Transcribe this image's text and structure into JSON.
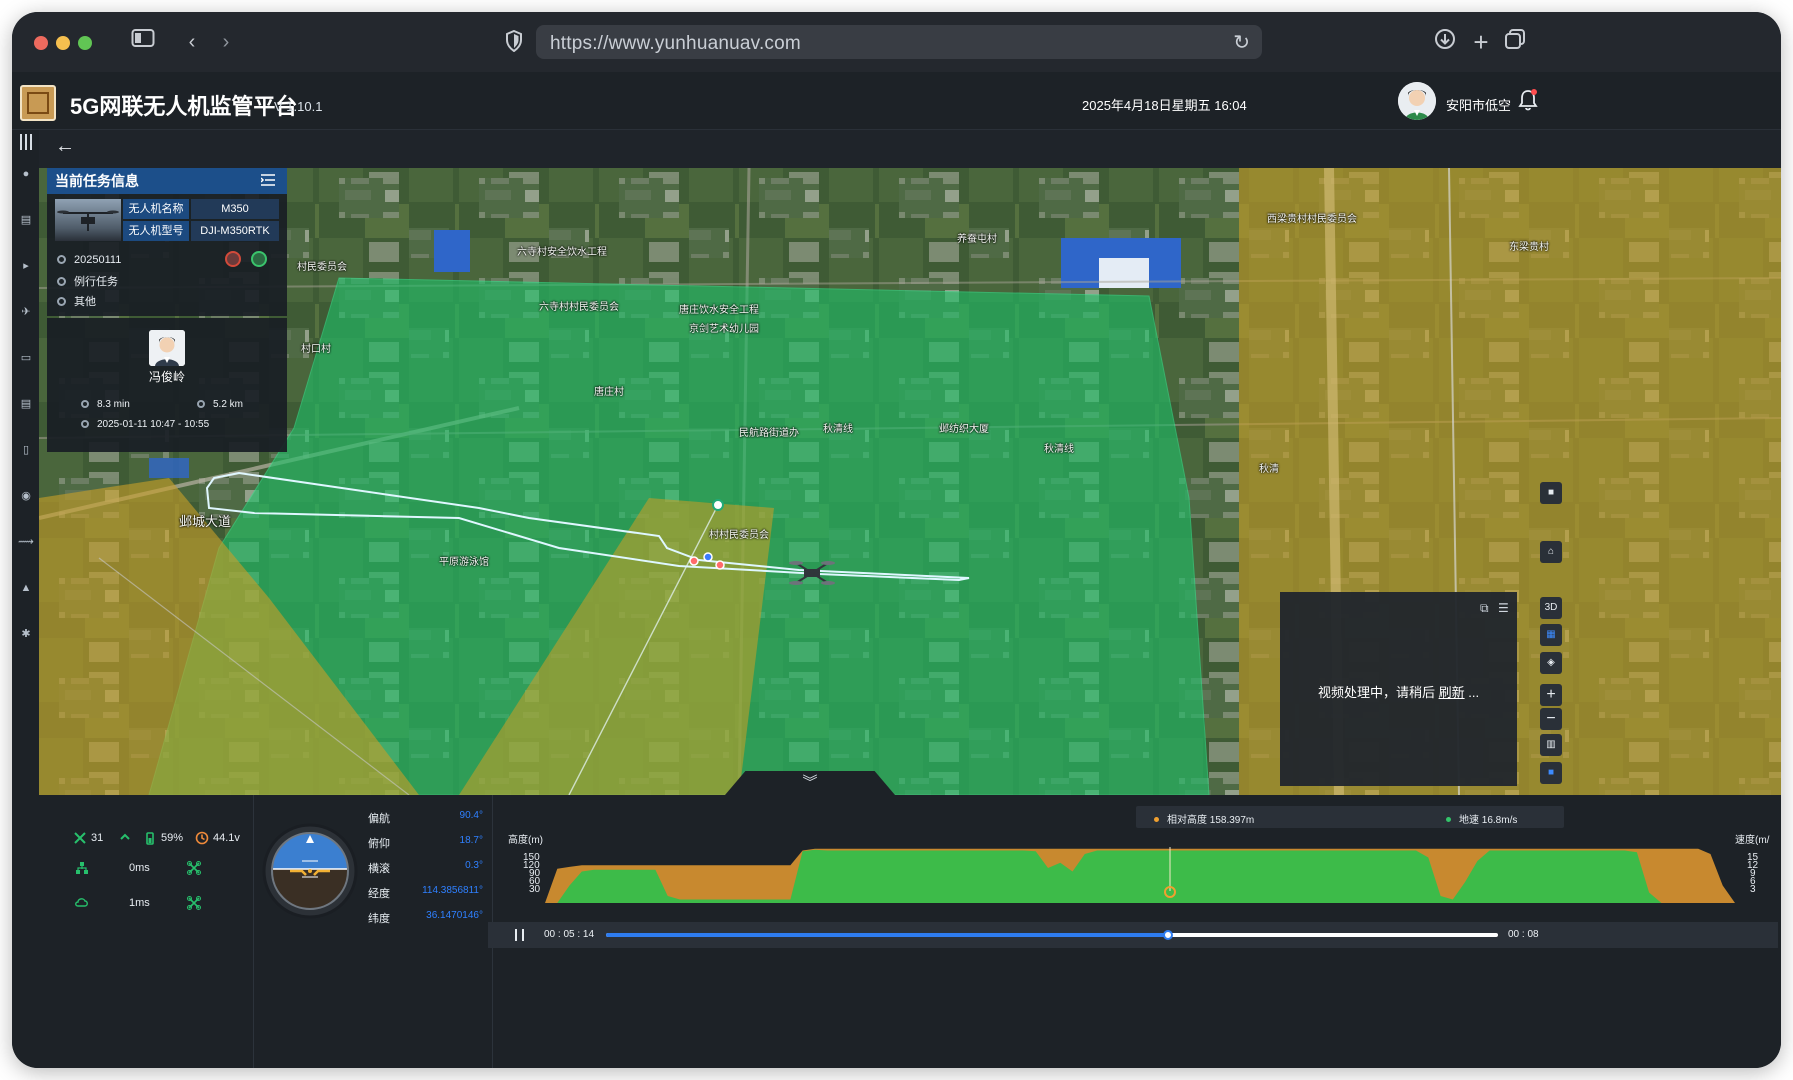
{
  "browser": {
    "url": "https://www.yunhuanuav.com"
  },
  "app": {
    "title": "5G网联无人机监管平台",
    "version": "V 1.10.1",
    "datetime": "2025年4月18日星期五 16:04",
    "user": "安阳市低空"
  },
  "task_panel": {
    "title": "当前任务信息",
    "drone_name_label": "无人机名称",
    "drone_name_value": "M350",
    "drone_model_label": "无人机型号",
    "drone_model_value": "DJI-M350RTK",
    "task_id": "20250111",
    "task_type": "例行任务",
    "task_category": "其他"
  },
  "pilot_panel": {
    "name": "冯俊岭",
    "duration": "8.3 min",
    "distance": "5.2 km",
    "time_range": "2025-01-11 10:47 - 10:55"
  },
  "map": {
    "labels": [
      "六寺村安全饮水工程",
      "养蚕屯村",
      "村民委员会",
      "六寺村村民委员会",
      "唐庄饮水安全工程",
      "京剑艺术幼儿园",
      "村口村",
      "唐庄村",
      "民航路街道办",
      "秋清线",
      "邺纺织大厦",
      "秋清线",
      "秋清",
      "邺城大道",
      "村村民委员会",
      "平原游泳馆",
      "西梁贵村村民委员会",
      "东梁贵村"
    ],
    "controls": [
      "3D"
    ],
    "colors": {
      "green_zone": "#1fbf68",
      "yellow_zone": "#c79e28",
      "track": "#dff7ff"
    }
  },
  "video": {
    "message_prefix": "视频处理中，请稍后",
    "message_link": "刷新",
    "message_suffix": "..."
  },
  "telemetry": {
    "satellites": "31",
    "battery": "59%",
    "voltage": "44.1v",
    "latency_1": "0ms",
    "latency_2": "1ms",
    "attitude": [
      {
        "label": "偏航",
        "value": "90.4°"
      },
      {
        "label": "俯仰",
        "value": "18.7°"
      },
      {
        "label": "横滚",
        "value": "0.3°"
      },
      {
        "label": "经度",
        "value": "114.3856811°"
      },
      {
        "label": "纬度",
        "value": "36.1470146°"
      }
    ]
  },
  "chart_data": {
    "type": "area",
    "xlabel": "",
    "ylabel_left": "高度(m)",
    "ylabel_right": "速度(m/",
    "left_ticks": [
      "150",
      "120",
      "90",
      "60",
      "30"
    ],
    "right_ticks": [
      "15",
      "12",
      "9",
      "6",
      "3"
    ],
    "ylim": [
      0,
      160
    ],
    "legend": [
      {
        "name": "相对高度 158.397m",
        "color": "#f0a030"
      },
      {
        "name": "地速 16.8m/s",
        "color": "#33c46a"
      }
    ],
    "series": [
      {
        "name": "相对高度",
        "color": "#c8892f",
        "values": [
          0,
          98,
          103,
          108,
          108,
          108,
          108,
          108,
          108,
          108,
          108,
          108,
          108,
          108,
          108,
          108,
          108,
          108,
          108,
          108,
          108,
          150,
          155,
          155,
          155,
          155,
          155,
          155,
          155,
          155,
          155,
          155,
          155,
          155,
          155,
          155,
          155,
          155,
          155,
          155,
          155,
          155,
          155,
          155,
          155,
          155,
          155,
          155,
          155,
          155,
          155,
          155,
          155,
          155,
          155,
          155,
          155,
          155,
          155,
          155,
          155,
          155,
          155,
          155,
          155,
          155,
          155,
          155,
          155,
          155,
          155,
          155,
          155,
          155,
          155,
          155,
          155,
          155,
          155,
          155,
          155,
          155,
          155,
          155,
          155,
          155,
          155,
          155,
          155,
          155,
          155,
          155,
          155,
          155,
          155,
          140,
          50,
          0
        ]
      },
      {
        "name": "地速",
        "color": "#3dbb49",
        "values": [
          0,
          0,
          50,
          90,
          95,
          95,
          95,
          95,
          95,
          95,
          20,
          10,
          10,
          10,
          10,
          10,
          10,
          10,
          10,
          10,
          10,
          148,
          152,
          150,
          150,
          150,
          150,
          150,
          150,
          150,
          150,
          150,
          150,
          150,
          150,
          150,
          150,
          150,
          150,
          150,
          148,
          100,
          115,
          90,
          140,
          150,
          150,
          150,
          150,
          150,
          150,
          150,
          150,
          150,
          150,
          150,
          150,
          150,
          150,
          150,
          150,
          150,
          150,
          150,
          150,
          150,
          150,
          150,
          150,
          150,
          150,
          150,
          130,
          20,
          10,
          60,
          120,
          150,
          150,
          150,
          150,
          150,
          150,
          150,
          150,
          150,
          150,
          150,
          150,
          145,
          30,
          0,
          0,
          0,
          0,
          0,
          0,
          0
        ]
      }
    ]
  },
  "playback": {
    "current": "00 : 05 : 14",
    "total": "00 : 08",
    "progress": 0.63
  }
}
